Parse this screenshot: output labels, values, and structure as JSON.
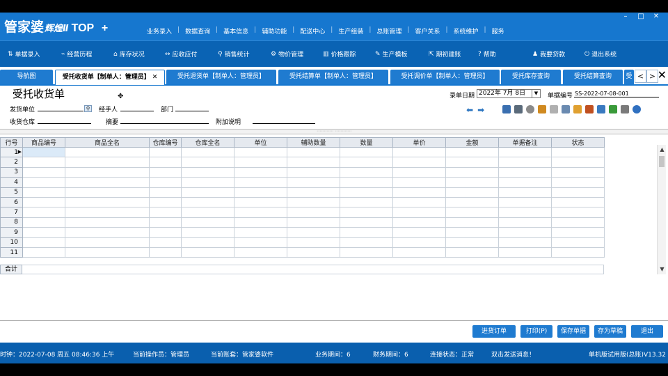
{
  "app": {
    "logo_main": "管家婆",
    "logo_sub": "辉煌Ⅱ",
    "logo_top": "TOP",
    "logo_plus": "+"
  },
  "window_controls": {
    "minimize": "–",
    "maximize": "□",
    "close": "✕"
  },
  "menu": [
    "业务录入",
    "数据查询",
    "基本信息",
    "辅助功能",
    "配送中心",
    "生产组装",
    "总账管理",
    "客户关系",
    "系统维护",
    "服务"
  ],
  "menu_separator": "|",
  "toolbar": [
    {
      "label": "单据录入",
      "icon": "document-icon",
      "glyph": "⇅"
    },
    {
      "label": "经营历程",
      "icon": "chart-icon",
      "glyph": "⌁"
    },
    {
      "label": "库存状况",
      "icon": "warehouse-icon",
      "glyph": "⌂"
    },
    {
      "label": "应收应付",
      "icon": "exchange-icon",
      "glyph": "↔"
    },
    {
      "label": "销售统计",
      "icon": "search-icon",
      "glyph": "⚲"
    },
    {
      "label": "物价管理",
      "icon": "gear-icon",
      "glyph": "⚙"
    },
    {
      "label": "价格跟踪",
      "icon": "bar-chart-icon",
      "glyph": "▥"
    },
    {
      "label": "生产模板",
      "icon": "wrench-icon",
      "glyph": "✎"
    },
    {
      "label": "期初建账",
      "icon": "export-icon",
      "glyph": "⇱"
    },
    {
      "label": "帮助",
      "icon": "help-icon",
      "glyph": "?"
    },
    {
      "label": "我要贷款",
      "icon": "user-icon",
      "glyph": "♟"
    },
    {
      "label": "退出系统",
      "icon": "power-icon",
      "glyph": "⏻"
    }
  ],
  "tabs": [
    {
      "label": "导航图",
      "active": false
    },
    {
      "label": "受托收货单【制单人：管理员】",
      "active": true,
      "close": "✕"
    },
    {
      "label": "受托退货单【制单人：管理员】",
      "active": false
    },
    {
      "label": "受托结算单【制单人：管理员】",
      "active": false
    },
    {
      "label": "受托调价单【制单人：管理员】",
      "active": false
    },
    {
      "label": "受托库存查询",
      "active": false
    },
    {
      "label": "受托结算查询",
      "active": false
    },
    {
      "label": "受",
      "active": false
    }
  ],
  "tab_nav": {
    "prev": "<",
    "next": ">",
    "close": "✕"
  },
  "form": {
    "title": "受托收货单",
    "cursor": "✥",
    "date_label": "录单日期",
    "date_value": "2022年 7月 8日",
    "date_dropdown": "▼",
    "bill_no_label": "单据编号",
    "bill_no_value": "SS-2022-07-08-001",
    "supplier_label": "发货单位",
    "handler_label": "经手人",
    "dept_label": "部门",
    "warehouse_label": "收货仓库",
    "summary_label": "摘要",
    "note_label": "附加说明",
    "search_glyph": "🔍",
    "arrow_prev": "➡",
    "arrow_next": "➡"
  },
  "action_icons": [
    {
      "name": "bar-chart-icon",
      "color": "#3a6fb0"
    },
    {
      "name": "printer-icon",
      "color": "#5a6a7a"
    },
    {
      "name": "settings-icon",
      "color": "#8a8a8a"
    },
    {
      "name": "import-icon",
      "color": "#d08a20"
    },
    {
      "name": "edit-icon",
      "color": "#b0b0b0"
    },
    {
      "name": "copy-icon",
      "color": "#6a8ab0"
    },
    {
      "name": "box-icon",
      "color": "#e0a030"
    },
    {
      "name": "book-icon",
      "color": "#c05020"
    },
    {
      "name": "person-icon",
      "color": "#3a7ac0"
    },
    {
      "name": "leaf-icon",
      "color": "#3a9a3a"
    },
    {
      "name": "link-icon",
      "color": "#7a7a7a"
    },
    {
      "name": "help-icon",
      "color": "#3070c0"
    }
  ],
  "splitter": "⋯⋯⋯⋯ ⋯⋯⋯⋯",
  "grid": {
    "columns": [
      "行号",
      "商品编号",
      "商品全名",
      "仓库编号",
      "仓库全名",
      "单位",
      "辅助数量",
      "数量",
      "单价",
      "金额",
      "单据备注",
      "状态"
    ],
    "rows": [
      "1",
      "2",
      "3",
      "4",
      "5",
      "6",
      "7",
      "8",
      "9",
      "10",
      "11"
    ],
    "total_label": "合计"
  },
  "scroll": {
    "up": "▲",
    "down": "▼"
  },
  "buttons": [
    "进货订单",
    "打印(P)",
    "保存单据",
    "存为草稿",
    "退出"
  ],
  "status": {
    "time": "时钟：2022-07-08 周五 08:46:36 上午",
    "operator": "当前操作员：管理员",
    "account": "当前账套：管家婆软件",
    "period": "业务期间：6",
    "fin_period": "财务期间：6",
    "conn": "连接状态：正常",
    "message": "双击发送消息！",
    "version": "单机版试用版(总账)V13.32"
  }
}
